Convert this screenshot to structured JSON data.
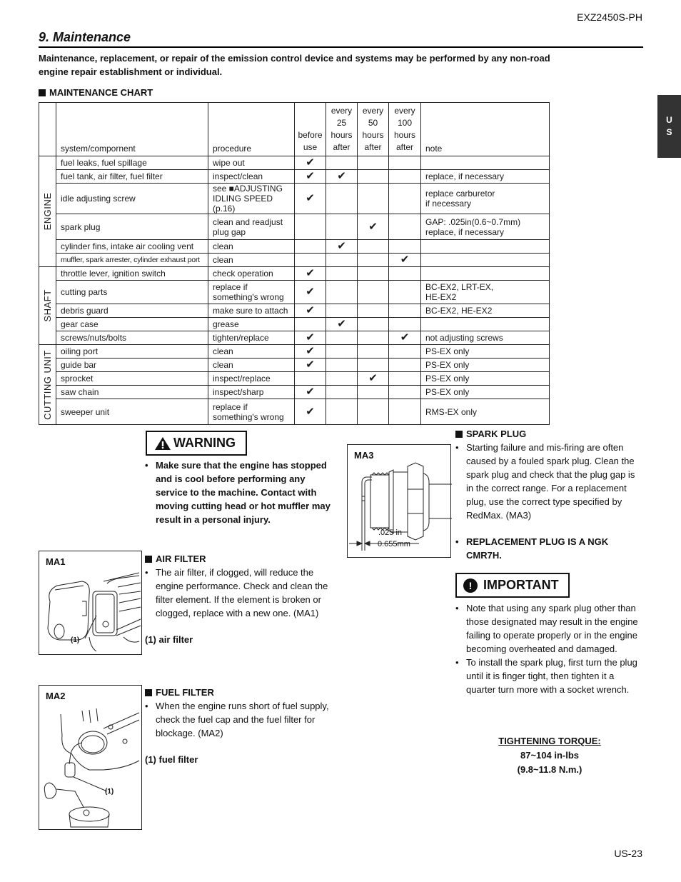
{
  "header": {
    "model": "EXZ2450S-PH",
    "section_title": "9. Maintenance",
    "intro": "Maintenance, replacement, or repair of the emission control device and systems may be performed by any non-road engine repair establishment or individual.",
    "chart_heading": "MAINTENANCE CHART"
  },
  "lang_tab": {
    "line1": "U",
    "line2": "S"
  },
  "maintenance_chart": {
    "headers": {
      "component": "system/compornent",
      "procedure": "procedure",
      "before_use": [
        "before",
        "use"
      ],
      "every_25": [
        "every",
        "25",
        "hours",
        "after"
      ],
      "every_50": [
        "every",
        "50",
        "hours",
        "after"
      ],
      "every_100": [
        "every",
        "100",
        "hours",
        "after"
      ],
      "note": "note"
    },
    "check_glyph": "✔",
    "groups": [
      {
        "name": "ENGINE",
        "rows": [
          {
            "component": "fuel leaks, fuel spillage",
            "procedure": [
              "wipe out"
            ],
            "before_use": true,
            "h25": false,
            "h50": false,
            "h100": false,
            "note": []
          },
          {
            "component": "fuel tank, air filter, fuel filter",
            "procedure": [
              "inspect/clean"
            ],
            "before_use": true,
            "h25": true,
            "h50": false,
            "h100": false,
            "note": [
              "replace, if necessary"
            ]
          },
          {
            "component": "idle adjusting screw",
            "procedure": [
              "see ■ADJUSTING",
              "IDLING SPEED (p.16)"
            ],
            "before_use": true,
            "h25": false,
            "h50": false,
            "h100": false,
            "note": [
              "replace carburetor",
              "if necessary"
            ]
          },
          {
            "component": "spark plug",
            "procedure": [
              "clean and readjust",
              "plug gap"
            ],
            "before_use": false,
            "h25": false,
            "h50": true,
            "h100": false,
            "note": [
              "GAP: .025in(0.6~0.7mm)",
              "replace, if necessary"
            ]
          },
          {
            "component": "cylinder fins, intake air cooling vent",
            "procedure": [
              "clean"
            ],
            "before_use": false,
            "h25": true,
            "h50": false,
            "h100": false,
            "note": []
          },
          {
            "component": "muffler, spark arrester, cylinder exhaust port",
            "procedure": [
              "clean"
            ],
            "before_use": false,
            "h25": false,
            "h50": false,
            "h100": true,
            "note": []
          }
        ]
      },
      {
        "name": "SHAFT",
        "rows": [
          {
            "component": "throttle lever, ignition switch",
            "procedure": [
              "check operation"
            ],
            "before_use": true,
            "h25": false,
            "h50": false,
            "h100": false,
            "note": []
          },
          {
            "component": "cutting parts",
            "procedure": [
              "replace if",
              "something's wrong"
            ],
            "before_use": true,
            "h25": false,
            "h50": false,
            "h100": false,
            "note": [
              "BC-EX2, LRT-EX,",
              "HE-EX2"
            ]
          },
          {
            "component": "debris guard",
            "procedure": [
              "make sure to attach"
            ],
            "before_use": true,
            "h25": false,
            "h50": false,
            "h100": false,
            "note": [
              "BC-EX2, HE-EX2"
            ]
          },
          {
            "component": "gear case",
            "procedure": [
              "grease"
            ],
            "before_use": false,
            "h25": true,
            "h50": false,
            "h100": false,
            "note": []
          },
          {
            "component": "screws/nuts/bolts",
            "procedure": [
              "tighten/replace"
            ],
            "before_use": true,
            "h25": false,
            "h50": false,
            "h100": true,
            "note": [
              "not adjusting screws"
            ]
          }
        ]
      },
      {
        "name": "CUTTING UNIT",
        "rows": [
          {
            "component": "oiling port",
            "procedure": [
              "clean"
            ],
            "before_use": true,
            "h25": false,
            "h50": false,
            "h100": false,
            "note": [
              "PS-EX only"
            ]
          },
          {
            "component": "guide bar",
            "procedure": [
              "clean"
            ],
            "before_use": true,
            "h25": false,
            "h50": false,
            "h100": false,
            "note": [
              "PS-EX only"
            ]
          },
          {
            "component": "sprocket",
            "procedure": [
              "inspect/replace"
            ],
            "before_use": false,
            "h25": false,
            "h50": true,
            "h100": false,
            "note": [
              "PS-EX only"
            ]
          },
          {
            "component": "saw chain",
            "procedure": [
              "inspect/sharp"
            ],
            "before_use": true,
            "h25": false,
            "h50": false,
            "h100": false,
            "note": [
              "PS-EX only"
            ]
          },
          {
            "component": "sweeper unit",
            "procedure": [
              "replace if",
              "something's wrong"
            ],
            "before_use": true,
            "h25": false,
            "h50": false,
            "h100": false,
            "note": [
              "RMS-EX only"
            ]
          }
        ]
      }
    ]
  },
  "warning": {
    "icon": "warning-triangle-icon",
    "label": "WARNING",
    "text": "Make sure that the engine has stopped and is cool before performing any service to the machine. Contact with moving cutting head or hot muffler may result in a personal injury."
  },
  "air_filter": {
    "figure_label": "MA1",
    "callout": "(1)",
    "heading": "AIR FILTER",
    "text": "The air filter, if clogged, will reduce the engine performance. Check and clean the filter element. If the element is broken or clogged, replace with a new one. (MA1)",
    "legend": "(1) air filter"
  },
  "fuel_filter": {
    "figure_label": "MA2",
    "callout": "(1)",
    "heading": "FUEL FILTER",
    "text": "When the engine runs short of fuel supply, check the fuel cap and the fuel filter for blockage. (MA2)",
    "legend": "(1) fuel filter"
  },
  "spark_plug": {
    "figure_label": "MA3",
    "gap_in": ".025 in",
    "gap_mm": "0.655mm",
    "heading": "SPARK PLUG",
    "text": "Starting failure and mis-firing are often caused by a fouled spark plug. Clean the spark plug and check that the plug gap is in the correct range. For a replacement plug, use the correct type specified by RedMax. (MA3)",
    "replacement": "REPLACEMENT PLUG IS A NGK CMR7H."
  },
  "important": {
    "icon": "exclamation-circle-icon",
    "label": "IMPORTANT",
    "items": [
      "Note that using any spark plug other than those designated may result in the engine failing to operate properly or in the engine becoming overheated and damaged.",
      "To install the spark plug, first turn the plug until it is finger tight, then tighten it a quarter turn more with a socket wrench."
    ]
  },
  "torque": {
    "heading": "TIGHTENING TORQUE:",
    "imperial": "87~104 in-lbs",
    "metric": "(9.8~11.8 N.m.)"
  },
  "footer": {
    "page": "US-23"
  }
}
